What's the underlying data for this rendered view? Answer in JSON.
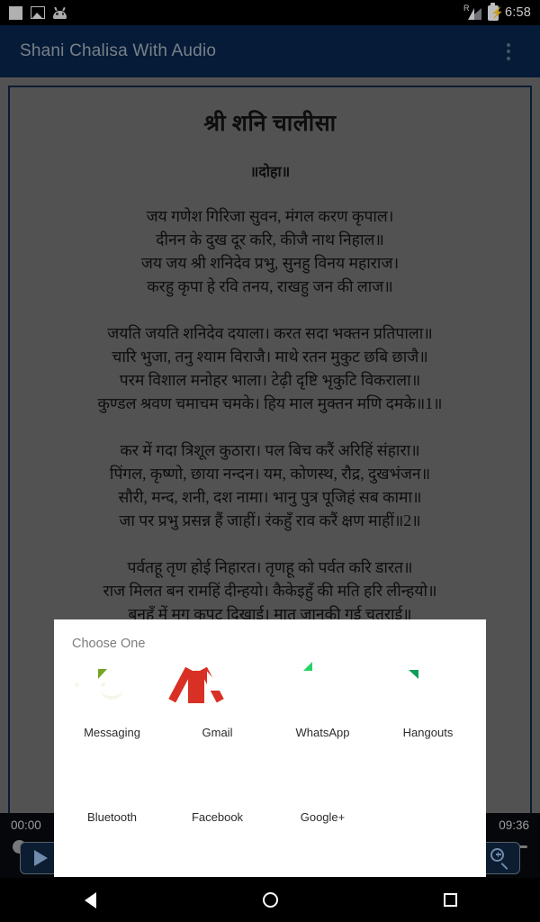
{
  "status_bar": {
    "time": "6:58",
    "left_icons": [
      "blank-square-icon",
      "screenshot-icon",
      "android-head-icon"
    ],
    "roaming_label": "R",
    "right_icons": [
      "signal-roaming-icon",
      "battery-charging-icon"
    ]
  },
  "app_bar": {
    "title": "Shani Chalisa With Audio",
    "overflow_icon": "overflow-menu-icon",
    "background": "#072347",
    "title_color": "#9aa4b0"
  },
  "content": {
    "head_title": "श्री शनि चालीसा",
    "doha_label": "॥दोहा॥",
    "stanzas": [
      {
        "lines": [
          "जय गणेश गिरिजा सुवन, मंगल करण कृपाल।",
          "दीनन के दुख दूर करि, कीजै नाथ निहाल॥",
          "जय जय श्री शनिदेव प्रभु, सुनहु विनय महाराज।",
          "करहु कृपा हे रवि तनय, राखहु जन की लाज॥"
        ]
      },
      {
        "lines": [
          "जयति जयति शनिदेव दयाला। करत सदा भक्तन प्रतिपाला॥",
          "चारि भुजा, तनु श्याम विराजै। माथे रतन मुकुट छबि छाजै॥",
          "परम विशाल मनोहर भाला। टेढ़ी दृष्टि भृकुटि विकराला॥",
          "कुण्डल श्रवण चमाचम चमके। हिय माल मुक्तन मणि दमके॥1॥"
        ]
      },
      {
        "lines": [
          "कर में गदा त्रिशूल कुठारा। पल बिच करैं अरिहिं संहारा॥",
          "पिंगल, कृष्णो, छाया नन्दन। यम, कोणस्थ, रौद्र, दुखभंजन॥",
          "सौरी, मन्द, शनी, दश नामा। भानु पुत्र पूजिहं सब कामा॥",
          "जा पर प्रभु प्रसन्न हैं जाहीं। रंकहुँ राव करैं क्षण माहीं॥2॥"
        ]
      },
      {
        "lines": [
          "पर्वतहू तृण होई निहारत। तृणहू को पर्वत करि डारत॥",
          "राज मिलत बन रामहिं दीन्हयो। कैकेइहुँ की मति हरि लीन्हयो॥",
          "बनहूँ में मृग कपट दिखाई। मातु जानकी गई चतुराई॥"
        ]
      }
    ]
  },
  "player": {
    "current_time": "00:00",
    "total_time": "09:36",
    "play_icon": "play-icon",
    "zoom_in_icon": "zoom-in-icon",
    "progress_percent": 0
  },
  "dialog": {
    "title": "Choose One",
    "apps": [
      {
        "label": "Messaging",
        "icon": "messaging-icon"
      },
      {
        "label": "Gmail",
        "icon": "gmail-icon"
      },
      {
        "label": "WhatsApp",
        "icon": "whatsapp-icon"
      },
      {
        "label": "Hangouts",
        "icon": "hangouts-icon"
      },
      {
        "label": "Bluetooth",
        "icon": "bluetooth-icon"
      },
      {
        "label": "Facebook",
        "icon": "facebook-icon"
      },
      {
        "label": "Google+",
        "icon": "google-plus-icon"
      }
    ]
  },
  "nav_bar": {
    "back_icon": "back-icon",
    "home_icon": "home-icon",
    "recents_icon": "recents-icon"
  }
}
